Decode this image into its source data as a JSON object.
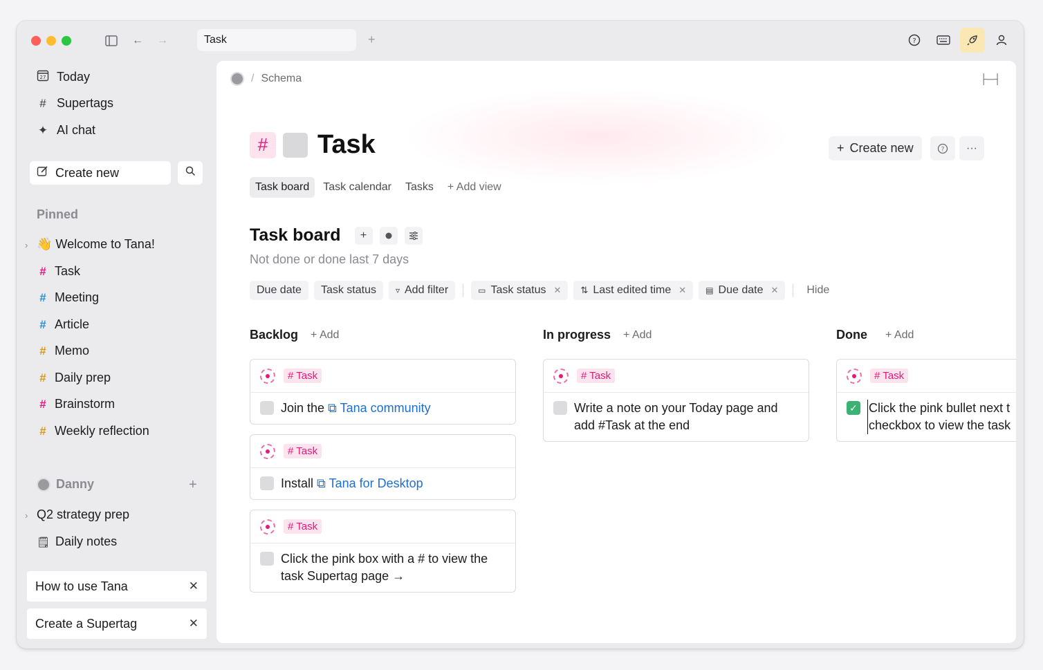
{
  "titlebar": {
    "tab_title": "Task",
    "new_tab": "+",
    "icons": [
      "sidebar-toggle-icon",
      "back-arrow-icon",
      "forward-arrow-icon",
      "help-icon",
      "keyboard-icon",
      "rocket-icon",
      "user-icon"
    ]
  },
  "sidebar": {
    "nav": [
      {
        "label": "Today",
        "icon": "calendar-icon"
      },
      {
        "label": "Supertags",
        "icon": "hash-icon"
      },
      {
        "label": "AI chat",
        "icon": "sparkle-icon"
      }
    ],
    "create_new": "Create new",
    "pinned_label": "Pinned",
    "pinned": [
      {
        "label": "👋 Welcome to Tana!",
        "color": "#1c1c1e"
      },
      {
        "label": "Task",
        "color": "#e5197b"
      },
      {
        "label": "Meeting",
        "color": "#2a8fd6"
      },
      {
        "label": "Article",
        "color": "#2a8fd6"
      },
      {
        "label": "Memo",
        "color": "#d69a18"
      },
      {
        "label": "Daily prep",
        "color": "#d69a18"
      },
      {
        "label": "Brainstorm",
        "color": "#e5197b"
      },
      {
        "label": "Weekly reflection",
        "color": "#d69a18"
      }
    ],
    "workspace_label": "Danny",
    "workspace_items": [
      "Q2 strategy prep",
      "Daily notes"
    ],
    "quick_cards": [
      "How to use Tana",
      "Create a Supertag"
    ]
  },
  "main": {
    "breadcrumb": "Schema",
    "title": "Task",
    "create_new": "Create new",
    "views": [
      "Task board",
      "Task calendar",
      "Tasks"
    ],
    "add_view": "Add view",
    "board_title": "Task board",
    "board_subtitle": "Not done or done last 7 days",
    "filters": [
      "Due date",
      "Task status",
      "Add filter"
    ],
    "sorts": [
      "Task status",
      "Last edited time",
      "Due date"
    ],
    "hide": "Hide",
    "tag_label": "# Task",
    "add_label": "Add",
    "columns": [
      {
        "name": "Backlog"
      },
      {
        "name": "In progress"
      },
      {
        "name": "Done"
      }
    ],
    "cards": {
      "c1": {
        "pre": "Join the ",
        "link": "Tana community"
      },
      "c2": {
        "pre": "Install ",
        "link": "Tana for Desktop"
      },
      "c3": {
        "line1": "Click the pink box with a # to view the",
        "line2": "task Supertag page →"
      },
      "c4": {
        "line1": "Write a note on your Today page and",
        "line2": "add #Task at the end"
      },
      "c5": {
        "line1": "Click the pink bullet next t",
        "line2": "checkbox to view the task"
      }
    }
  }
}
